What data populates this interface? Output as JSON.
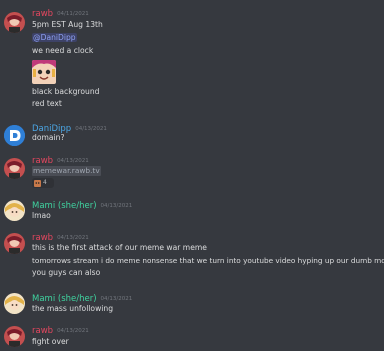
{
  "colors": {
    "background": "#36393f",
    "rawb": "#e4475f",
    "danidipp": "#4ba7e6",
    "mami": "#3fd4a0",
    "timestamp": "#72767d",
    "text": "#dcddde",
    "mention": "#8ea1f5"
  },
  "messages": [
    {
      "author": "rawb",
      "timestamp": "04/11/2021",
      "avatar": "rawb-avatar",
      "lines": [
        "5pm EST Aug 13th",
        "@DaniDipp",
        "we need a clock",
        "black background",
        "red text"
      ]
    },
    {
      "author": "DaniDipp",
      "timestamp": "04/13/2021",
      "avatar": "danidipp-avatar",
      "lines": [
        "domain?"
      ]
    },
    {
      "author": "rawb",
      "timestamp": "04/13/2021",
      "avatar": "rawb-avatar",
      "link": "memewar.rawb.tv",
      "reaction_count": "4"
    },
    {
      "author": "Mami (she/her)",
      "timestamp": "04/13/2021",
      "avatar": "mami-avatar",
      "lines": [
        "lmao"
      ]
    },
    {
      "author": "rawb",
      "timestamp": "04/13/2021",
      "avatar": "rawb-avatar",
      "lines": [
        "this is the first attack of our meme war meme",
        "tomorrows stream i do meme nonsense that we turn into youtube video hyping up our dumb move",
        "you guys can also"
      ]
    },
    {
      "author": "Mami (she/her)",
      "timestamp": "04/13/2021",
      "avatar": "mami-avatar",
      "lines": [
        "the mass unfollowing"
      ]
    },
    {
      "author": "rawb",
      "timestamp": "04/13/2021",
      "avatar": "rawb-avatar",
      "lines": [
        "fight over"
      ]
    }
  ]
}
